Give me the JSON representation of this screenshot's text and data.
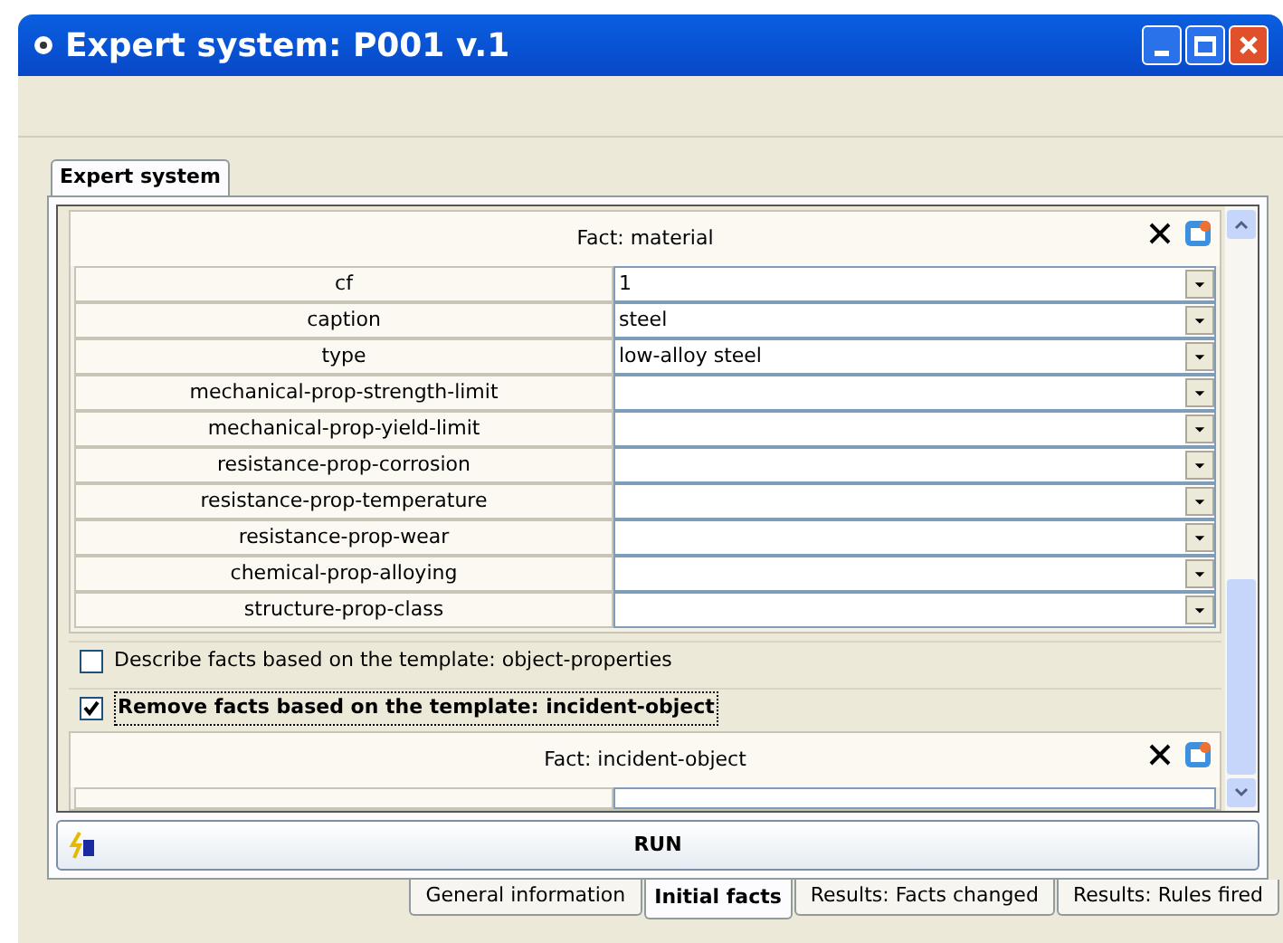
{
  "window": {
    "title": "Expert system: P001 v.1"
  },
  "top_tab": {
    "label": "Expert system",
    "selected": true
  },
  "facts": [
    {
      "title": "Fact: material",
      "rows": [
        {
          "name": "cf",
          "value": "1"
        },
        {
          "name": "caption",
          "value": "steel"
        },
        {
          "name": "type",
          "value": "low-alloy steel"
        },
        {
          "name": "mechanical-prop-strength-limit"
        },
        {
          "name": "mechanical-prop-yield-limit"
        },
        {
          "name": "resistance-prop-corrosion"
        },
        {
          "name": "resistance-prop-temperature"
        },
        {
          "name": "resistance-prop-wear"
        },
        {
          "name": "chemical-prop-alloying"
        },
        {
          "name": "structure-prop-class"
        }
      ]
    },
    {
      "kind": "checkbox",
      "label": "Describe facts based on the template: object-properties",
      "checked": false
    },
    {
      "kind": "checkbox",
      "label": "Remove facts based on the template: incident-object",
      "checked": true
    },
    {
      "title": "Fact: incident-object"
    }
  ],
  "run_button": {
    "label": "RUN"
  },
  "bottom_tabs": [
    {
      "label": "General information",
      "selected": false
    },
    {
      "label": "Initial facts",
      "selected": true
    },
    {
      "label": "Results: Facts changed",
      "selected": false
    },
    {
      "label": "Results: Rules fired",
      "selected": false
    }
  ]
}
